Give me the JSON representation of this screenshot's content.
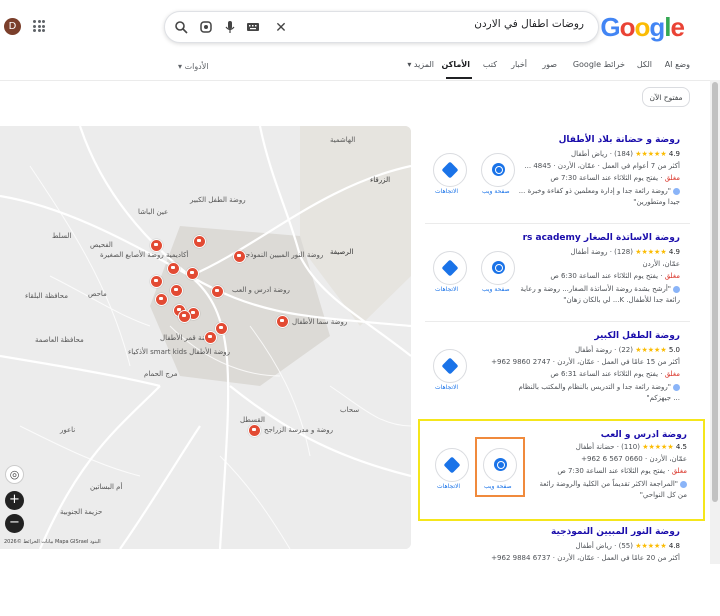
{
  "search": {
    "query": "روضات اطفال في الاردن",
    "logo_text": "Google",
    "clear_icon": "close-icon",
    "icons": [
      "close-icon",
      "keyboard-icon",
      "mic-icon",
      "lens-icon",
      "search-icon"
    ]
  },
  "user": {
    "initial": "D"
  },
  "tabs": {
    "items": [
      "وضع AI",
      "الكل",
      "خرائط Google",
      "صور",
      "أخبار",
      "كتب",
      "الأماكن",
      "المزيد"
    ],
    "active": "الأماكن",
    "tools": "الأدوات"
  },
  "filters": {
    "open_now": "مفتوح الآن"
  },
  "map": {
    "labels": [
      "روضة و حضانة بلاد الأطفال",
      "روضة النور المبيين النموذجية",
      "روضة الطفل الكبير",
      "أكاديمية روضة الأصابع الصغيرة",
      "روضة ادرس و العب",
      "روضة سما الأطفال",
      "روضة الأطفال smart kids الأذكياء",
      "روضة قمر الأطفال",
      "روضة و مدرسة الزراجح",
      "الرصيفة",
      "الزرقاء",
      "السلط",
      "ماحص",
      "الفحيص",
      "عين الباشا",
      "جرش",
      "مرج الحمام",
      "سحاب",
      "الجيزة",
      "أم البساتين",
      "ناعور",
      "البصة",
      "محافظة البلقاء",
      "محافظة العاصمة",
      "الهاشمية",
      "حزيمة الجنوبية",
      "القسطل",
      "الزرقاء الجديدة",
      "الموقر"
    ],
    "attribution": "بيانات الخرائط ©2026 Mapa GISrael  البنود",
    "zoom_in": "+",
    "zoom_out": "−"
  },
  "results": [
    {
      "name": "روضة و حضانة بلاد الأطفال",
      "rating": "4.9",
      "stars": "★★★★★",
      "reviews": "(184)",
      "type": "رياض أطفال",
      "line2": "أكثر من 7 أعوام في العمل · عمّان، الأردن · 4845 ...",
      "open": "مغلق",
      "hours": "· يفتح يوم الثلاثاء عند الساعة 7:30 ص",
      "quote": "\"روضة رائعة جدا و إدارة ومعلمين ذو كفاءة وخبرة ... جيدا ومتطورين\"",
      "web_label": "صفحة ويب",
      "dir_label": "الاتجاهات"
    },
    {
      "name": "روضة الاساتذة الصغار rs academy",
      "rating": "4.9",
      "stars": "★★★★★",
      "reviews": "(128)",
      "type": "روضة أطفال",
      "line2": "عمّان، الأردن",
      "open": "مغلق",
      "hours": "· يفتح يوم الثلاثاء عند الساعة 6:30 ص",
      "quote": "\"أرشح بشدة روضة الأساتذة الصغار... روضة و رعاية رائعة جدا للأطفال. K... لي بالكان زهان\"",
      "web_label": "صفحة ويب",
      "dir_label": "الاتجاهات"
    },
    {
      "name": "روضة الطفل الكبير",
      "rating": "5.0",
      "stars": "★★★★★",
      "reviews": "(22)",
      "type": "روضة أطفال",
      "line2": "أكثر من 15 عامًا في العمل · عمّان، الأردن · 2747 9860 962+",
      "open": "مغلق",
      "hours": "· يفتح يوم الثلاثاء عند الساعة 6:31 ص",
      "quote": "\"روضة رائعة جدا و التدريس بالنظام والمكتب بالنظام ... جيهزكم\"",
      "web_label": "",
      "dir_label": "الاتجاهات"
    },
    {
      "name": "روضة ادرس و العب",
      "rating": "4.5",
      "stars": "★★★★★",
      "reviews": "(110)",
      "type": "حضانة أطفال",
      "line2": "عمّان، الأردن · 0660 567 6 962+",
      "open": "مغلق",
      "hours": "· يفتح يوم الثلاثاء عند الساعة 7:30 ص",
      "quote": "\"المراجعة الاكثر تقديماً من الكلية والروضة رائعة من كل النواحي\"",
      "web_label": "صفحة ويب",
      "dir_label": "الاتجاهات"
    },
    {
      "name": "روضة النور المبيين النموذجية",
      "rating": "4.8",
      "stars": "★★★★★",
      "reviews": "(55)",
      "type": "رياض أطفال",
      "line2": "أكثر من 20 عامًا في العمل · عمّان، الأردن · 6737 9884 962+",
      "open": "",
      "hours": "",
      "quote": "",
      "web_label": "",
      "dir_label": ""
    }
  ]
}
